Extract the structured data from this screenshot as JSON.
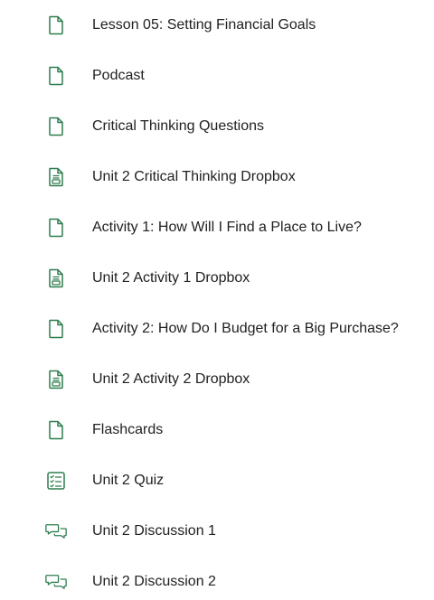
{
  "accent_color": "#2e7d4f",
  "items": [
    {
      "label": "Lesson 05: Setting Financial Goals",
      "icon": "document-icon"
    },
    {
      "label": "Podcast",
      "icon": "document-icon"
    },
    {
      "label": "Critical Thinking Questions",
      "icon": "document-icon"
    },
    {
      "label": "Unit 2 Critical Thinking Dropbox",
      "icon": "dropbox-icon"
    },
    {
      "label": "Activity 1: How Will I Find a Place to Live?",
      "icon": "document-icon"
    },
    {
      "label": "Unit 2 Activity 1 Dropbox",
      "icon": "dropbox-icon"
    },
    {
      "label": "Activity 2: How Do I Budget for a Big Purchase?",
      "icon": "document-icon"
    },
    {
      "label": "Unit 2 Activity 2 Dropbox",
      "icon": "dropbox-icon"
    },
    {
      "label": "Flashcards",
      "icon": "document-icon"
    },
    {
      "label": "Unit 2 Quiz",
      "icon": "quiz-icon"
    },
    {
      "label": "Unit 2 Discussion 1",
      "icon": "discussion-icon"
    },
    {
      "label": "Unit 2 Discussion 2",
      "icon": "discussion-icon"
    }
  ]
}
